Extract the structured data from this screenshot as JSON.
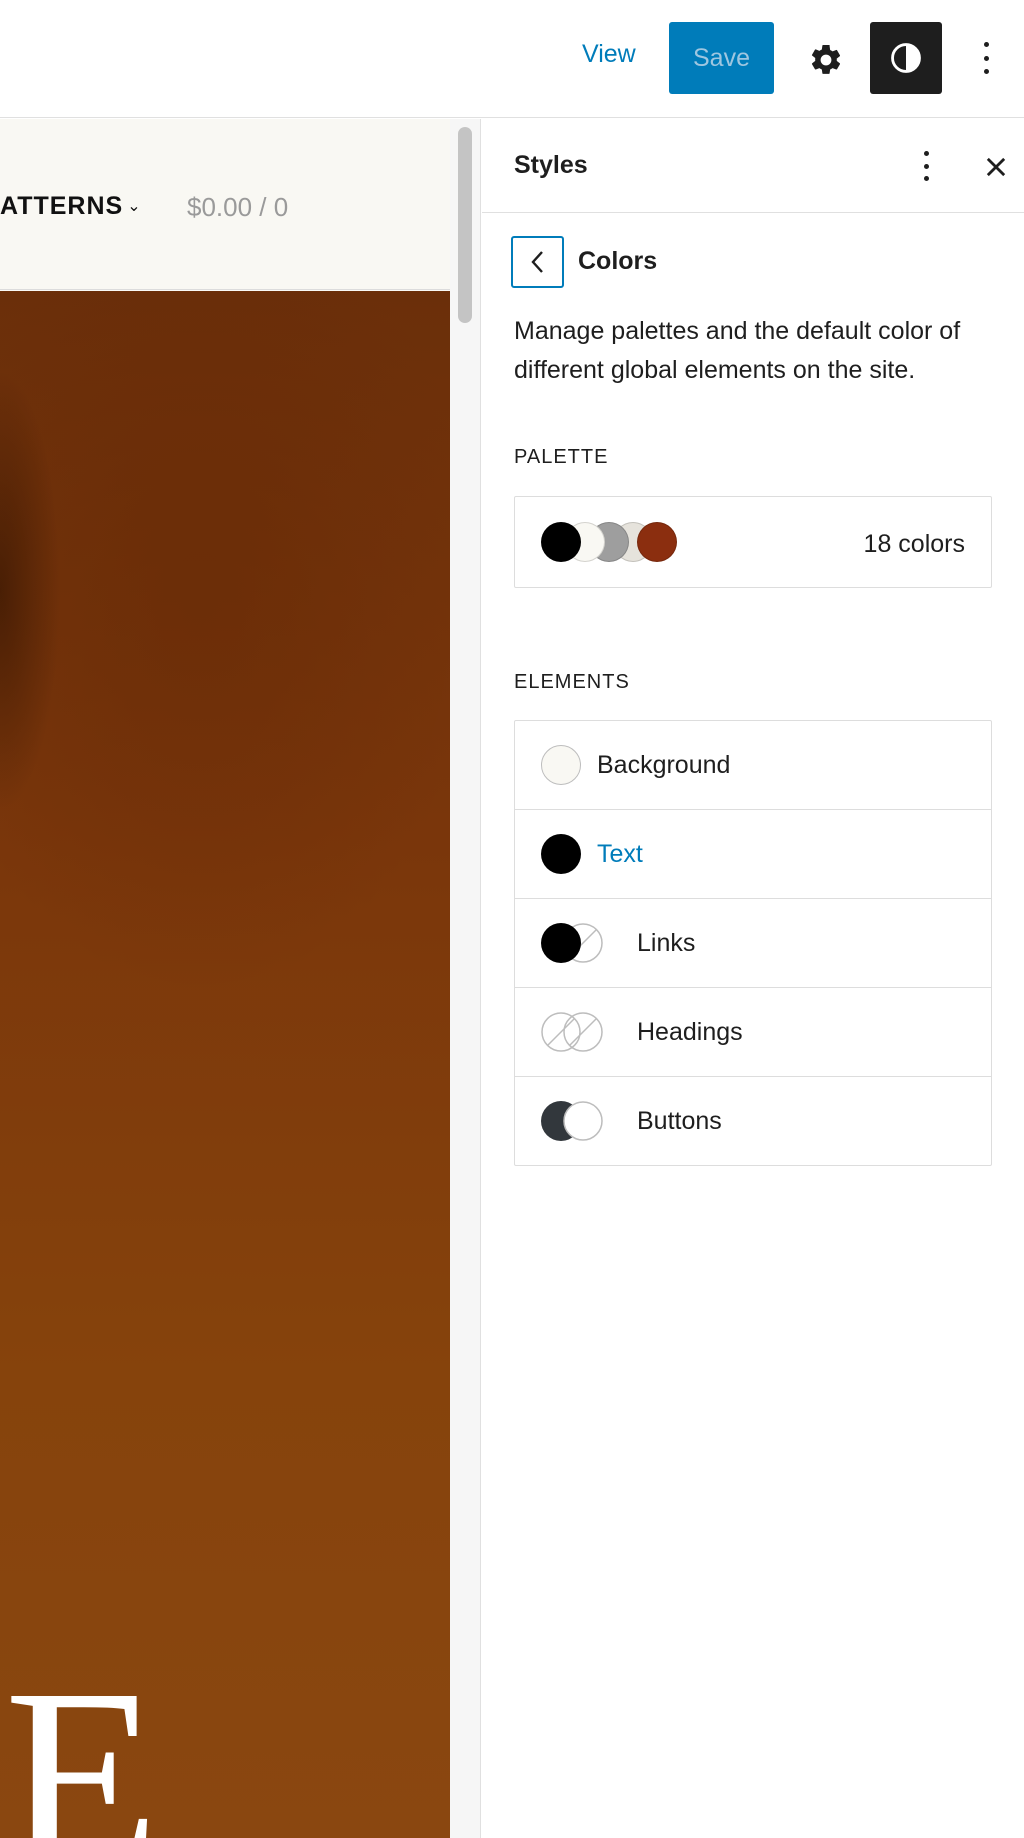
{
  "topbar": {
    "view_label": "View",
    "save_label": "Save"
  },
  "canvas": {
    "nav_item": "ATTERNS",
    "cart": "$0.00 / 0",
    "hero_letter": "E"
  },
  "sidebar": {
    "title": "Styles",
    "subpanel_title": "Colors",
    "description": "Manage palettes and the default color of different global elements on the site.",
    "palette_label": "PALETTE",
    "palette_count": "18 colors",
    "palette_swatches": [
      "#000000",
      "#f9f8f3",
      "#9e9e9e",
      "#e6e3dc",
      "#8b2e0f"
    ],
    "elements_label": "ELEMENTS",
    "elements": [
      {
        "label": "Background",
        "active": false
      },
      {
        "label": "Text",
        "active": true
      },
      {
        "label": "Links",
        "active": false
      },
      {
        "label": "Headings",
        "active": false
      },
      {
        "label": "Buttons",
        "active": false
      }
    ]
  },
  "colors": {
    "accent": "#007cba",
    "dark": "#1e1e1e",
    "hero": "#7a360b"
  }
}
